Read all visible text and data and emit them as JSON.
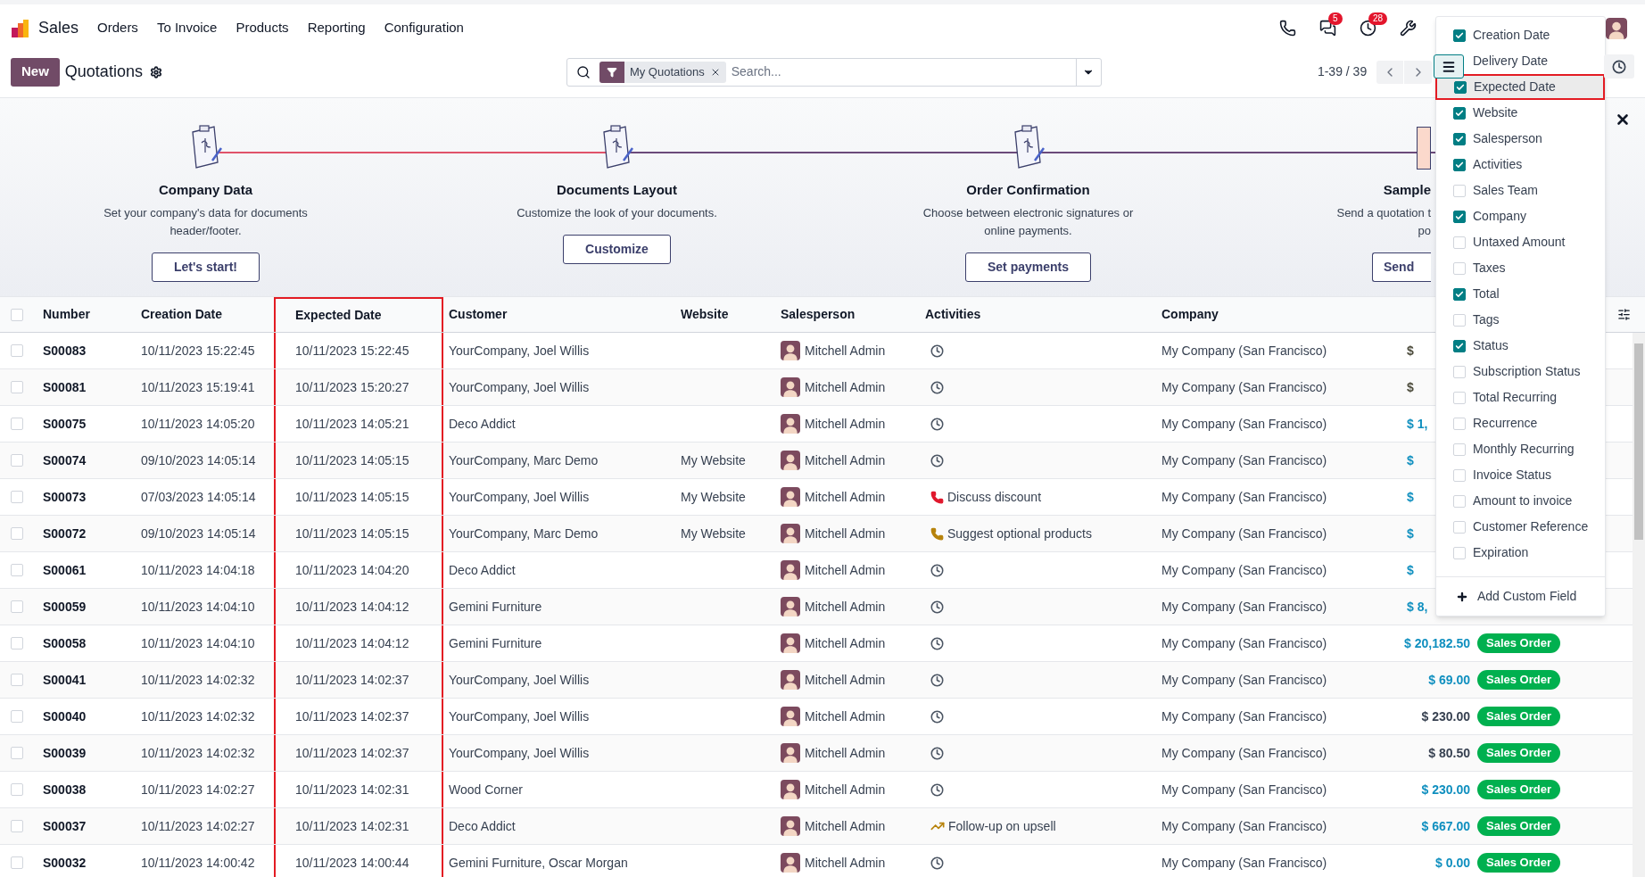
{
  "app": {
    "name": "Sales",
    "menu": [
      "Orders",
      "To Invoice",
      "Products",
      "Reporting",
      "Configuration"
    ],
    "notifications": [
      {
        "kind": "phone"
      },
      {
        "kind": "chat",
        "count": "5"
      },
      {
        "kind": "activity",
        "count": "28"
      },
      {
        "kind": "tools"
      }
    ]
  },
  "control_bar": {
    "new_button": "New",
    "title": "Quotations",
    "search": {
      "facet": "My Quotations",
      "placeholder": "Search..."
    },
    "pager": "1-39 / 39",
    "views": [
      {
        "kind": "list",
        "selected": true
      },
      {
        "kind": "activity",
        "selected": false
      }
    ]
  },
  "onboarding": {
    "steps": [
      {
        "kind": "full",
        "title": "Company Data",
        "description": "Set your company's data for documents header/footer.",
        "button": "Let's start!"
      },
      {
        "kind": "full",
        "title": "Documents Layout",
        "description": "Customize the look of your documents.",
        "button": "Customize"
      },
      {
        "kind": "full",
        "title": "Order Confirmation",
        "description": "Choose between electronic signatures or online payments.",
        "button": "Set payments"
      },
      {
        "kind": "cut",
        "title": "Sample",
        "description": "Send a quotation t",
        "description_2": "po",
        "button": "Send"
      }
    ]
  },
  "table": {
    "all_selected": false,
    "columns": [
      {
        "label": "Number",
        "highlighted": false
      },
      {
        "label": "Creation Date",
        "highlighted": false
      },
      {
        "label": "Expected Date",
        "highlighted": true
      },
      {
        "label": "Customer",
        "highlighted": false
      },
      {
        "label": "Website",
        "highlighted": false
      },
      {
        "label": "Salesperson",
        "highlighted": false
      },
      {
        "label": "Activities",
        "highlighted": false
      },
      {
        "label": "Company",
        "highlighted": false
      }
    ],
    "rows": [
      {
        "selected": false,
        "number": "S00083",
        "created": "10/11/2023 15:22:45",
        "expected": "10/11/2023 15:22:45",
        "customer": "YourCompany, Joel Willis",
        "salesperson": "Mitchell Admin",
        "activity": {
          "kind": "none"
        },
        "company": "My Company (San Francisco)",
        "total": {
          "text": "$",
          "color": "#4b4a3a"
        }
      },
      {
        "selected": false,
        "number": "S00081",
        "created": "10/11/2023 15:19:41",
        "expected": "10/11/2023 15:20:27",
        "customer": "YourCompany, Joel Willis",
        "salesperson": "Mitchell Admin",
        "activity": {
          "kind": "none"
        },
        "company": "My Company (San Francisco)",
        "total": {
          "text": "$",
          "color": "#4b4a3a"
        }
      },
      {
        "selected": false,
        "number": "S00075",
        "created": "10/11/2023 14:05:20",
        "expected": "10/11/2023 14:05:21",
        "customer": "Deco Addict",
        "salesperson": "Mitchell Admin",
        "activity": {
          "kind": "none"
        },
        "company": "My Company (San Francisco)",
        "total": {
          "text": "$ 1,",
          "color": "#0f8fbf"
        }
      },
      {
        "selected": false,
        "number": "S00074",
        "created": "09/10/2023 14:05:14",
        "expected": "10/11/2023 14:05:15",
        "customer": "YourCompany, Marc Demo",
        "website": "My Website",
        "salesperson": "Mitchell Admin",
        "activity": {
          "kind": "none"
        },
        "company": "My Company (San Francisco)",
        "total": {
          "text": "$",
          "color": "#0f8fbf"
        }
      },
      {
        "selected": false,
        "number": "S00073",
        "created": "07/03/2023 14:05:14",
        "expected": "10/11/2023 14:05:15",
        "customer": "YourCompany, Joel Willis",
        "website": "My Website",
        "salesperson": "Mitchell Admin",
        "activity": {
          "kind": "call",
          "text": "Discuss discount",
          "color": "#e0182d"
        },
        "company": "My Company (San Francisco)",
        "total": {
          "text": "$",
          "color": "#0f8fbf"
        }
      },
      {
        "selected": false,
        "number": "S00072",
        "created": "09/10/2023 14:05:14",
        "expected": "10/11/2023 14:05:15",
        "customer": "YourCompany, Marc Demo",
        "website": "My Website",
        "salesperson": "Mitchell Admin",
        "activity": {
          "kind": "call",
          "text": "Suggest optional products",
          "color": "#b7830c"
        },
        "company": "My Company (San Francisco)",
        "total": {
          "text": "$",
          "color": "#0f8fbf"
        }
      },
      {
        "selected": false,
        "number": "S00061",
        "created": "10/11/2023 14:04:18",
        "expected": "10/11/2023 14:04:20",
        "customer": "Deco Addict",
        "salesperson": "Mitchell Admin",
        "activity": {
          "kind": "none"
        },
        "company": "My Company (San Francisco)",
        "total": {
          "text": "$",
          "color": "#0f8fbf"
        }
      },
      {
        "selected": false,
        "number": "S00059",
        "created": "10/11/2023 14:04:10",
        "expected": "10/11/2023 14:04:12",
        "customer": "Gemini Furniture",
        "salesperson": "Mitchell Admin",
        "activity": {
          "kind": "none"
        },
        "company": "My Company (San Francisco)",
        "total": {
          "text": "$ 8,",
          "color": "#0f8fbf"
        }
      },
      {
        "selected": false,
        "number": "S00058",
        "created": "10/11/2023 14:04:10",
        "expected": "10/11/2023 14:04:12",
        "customer": "Gemini Furniture",
        "salesperson": "Mitchell Admin",
        "activity": {
          "kind": "none"
        },
        "company": "My Company (San Francisco)",
        "total": {
          "text": "$ 20,182.50",
          "color": "#0f8fbf"
        },
        "status": "Sales Order"
      },
      {
        "selected": false,
        "number": "S00041",
        "created": "10/11/2023 14:02:32",
        "expected": "10/11/2023 14:02:37",
        "customer": "YourCompany, Joel Willis",
        "salesperson": "Mitchell Admin",
        "activity": {
          "kind": "none"
        },
        "company": "My Company (San Francisco)",
        "total": {
          "text": "$ 69.00",
          "color": "#0f8fbf"
        },
        "status": "Sales Order"
      },
      {
        "selected": false,
        "number": "S00040",
        "created": "10/11/2023 14:02:32",
        "expected": "10/11/2023 14:02:37",
        "customer": "YourCompany, Joel Willis",
        "salesperson": "Mitchell Admin",
        "activity": {
          "kind": "none"
        },
        "company": "My Company (San Francisco)",
        "total": {
          "text": "$ 230.00",
          "color": "#374151"
        },
        "status": "Sales Order"
      },
      {
        "selected": false,
        "number": "S00039",
        "created": "10/11/2023 14:02:32",
        "expected": "10/11/2023 14:02:37",
        "customer": "YourCompany, Joel Willis",
        "salesperson": "Mitchell Admin",
        "activity": {
          "kind": "none"
        },
        "company": "My Company (San Francisco)",
        "total": {
          "text": "$ 80.50",
          "color": "#374151"
        },
        "status": "Sales Order"
      },
      {
        "selected": false,
        "number": "S00038",
        "created": "10/11/2023 14:02:27",
        "expected": "10/11/2023 14:02:31",
        "customer": "Wood Corner",
        "salesperson": "Mitchell Admin",
        "activity": {
          "kind": "none"
        },
        "company": "My Company (San Francisco)",
        "total": {
          "text": "$ 230.00",
          "color": "#0f8fbf"
        },
        "status": "Sales Order"
      },
      {
        "selected": false,
        "number": "S00037",
        "created": "10/11/2023 14:02:27",
        "expected": "10/11/2023 14:02:31",
        "customer": "Deco Addict",
        "salesperson": "Mitchell Admin",
        "activity": {
          "kind": "upsell",
          "text": "Follow-up on upsell",
          "color": "#b7830c"
        },
        "company": "My Company (San Francisco)",
        "total": {
          "text": "$ 667.00",
          "color": "#0f8fbf"
        },
        "status": "Sales Order"
      },
      {
        "selected": false,
        "number": "S00032",
        "created": "10/11/2023 14:00:42",
        "expected": "10/11/2023 14:00:44",
        "customer": "Gemini Furniture, Oscar Morgan",
        "salesperson": "Mitchell Admin",
        "activity": {
          "kind": "none"
        },
        "company": "My Company (San Francisco)",
        "total": {
          "text": "$ 0.00",
          "color": "#0f8fbf"
        },
        "status": "Sales Order"
      }
    ]
  },
  "column_menu": {
    "items": [
      {
        "label": "Creation Date",
        "checked": true,
        "highlighted": false
      },
      {
        "label": "Delivery Date",
        "highlighted": false
      },
      {
        "label": "Expected Date",
        "checked": true,
        "highlighted": true
      },
      {
        "label": "Website",
        "checked": true,
        "highlighted": false
      },
      {
        "label": "Salesperson",
        "checked": true,
        "highlighted": false
      },
      {
        "label": "Activities",
        "checked": true,
        "highlighted": false
      },
      {
        "label": "Sales Team",
        "checked": false,
        "highlighted": false
      },
      {
        "label": "Company",
        "checked": true,
        "highlighted": false
      },
      {
        "label": "Untaxed Amount",
        "checked": false,
        "highlighted": false
      },
      {
        "label": "Taxes",
        "checked": false,
        "highlighted": false
      },
      {
        "label": "Total",
        "checked": true,
        "highlighted": false
      },
      {
        "label": "Tags",
        "checked": false,
        "highlighted": false
      },
      {
        "label": "Status",
        "checked": true,
        "highlighted": false
      },
      {
        "label": "Subscription Status",
        "checked": false,
        "highlighted": false
      },
      {
        "label": "Total Recurring",
        "checked": false,
        "highlighted": false
      },
      {
        "label": "Recurrence",
        "checked": false,
        "highlighted": false
      },
      {
        "label": "Monthly Recurring",
        "checked": false,
        "highlighted": false
      },
      {
        "label": "Invoice Status",
        "checked": false,
        "highlighted": false
      },
      {
        "label": "Amount to invoice",
        "checked": false,
        "highlighted": false
      },
      {
        "label": "Customer Reference",
        "checked": false,
        "highlighted": false
      },
      {
        "label": "Expiration",
        "checked": false,
        "highlighted": false
      }
    ],
    "add_field": "Add Custom Field"
  }
}
